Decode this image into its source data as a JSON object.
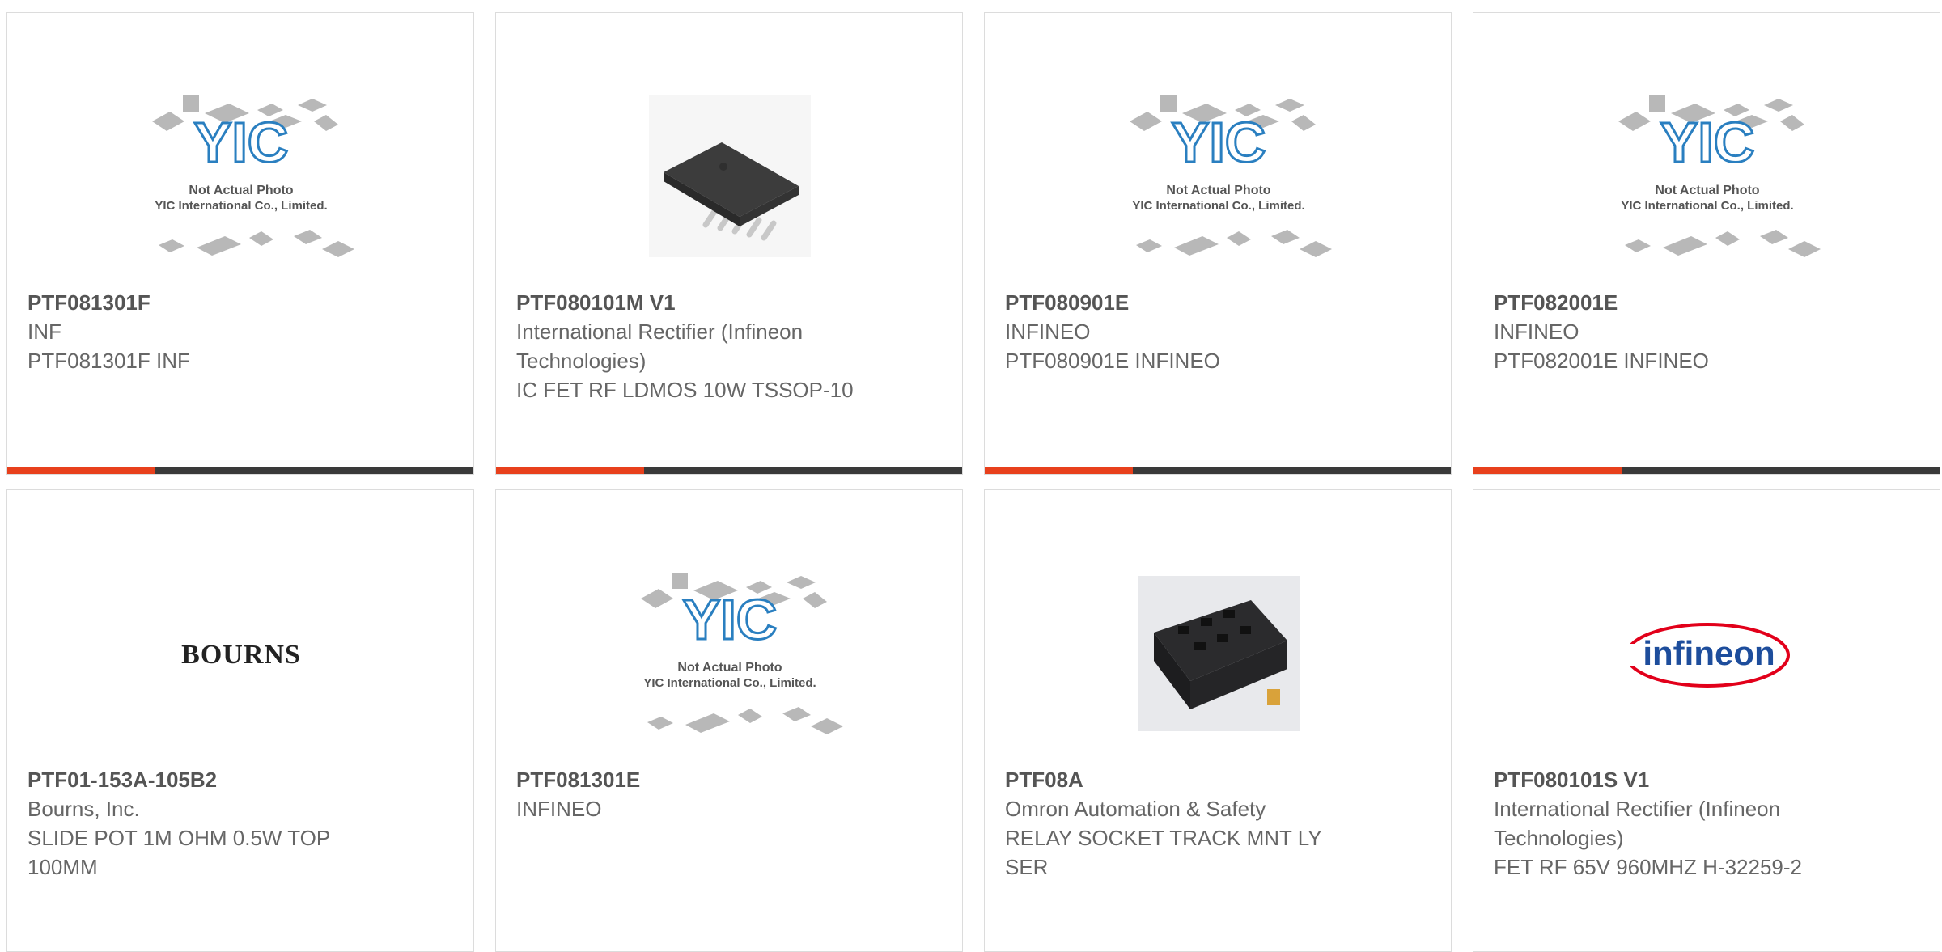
{
  "placeholder": {
    "line1": "Not Actual Photo",
    "line2": "YIC International Co., Limited.",
    "logo": "YIC"
  },
  "brand_logos": {
    "bourns": "BOURNS",
    "infineon": "infineon"
  },
  "colors": {
    "accent": "#e8401c",
    "bar": "#3a3a3a",
    "text": "#666666",
    "yic_blue": "#2a7fc0"
  },
  "cards": [
    {
      "part": "PTF081301F",
      "manufacturer": "INF",
      "description": "PTF081301F INF",
      "image": "yic-placeholder"
    },
    {
      "part": "PTF080101M V1",
      "manufacturer": "International Rectifier (Infineon Technologies)",
      "description": "IC FET RF LDMOS 10W TSSOP-10",
      "image": "tssop-chip-photo"
    },
    {
      "part": "PTF080901E",
      "manufacturer": "INFINEO",
      "description": "PTF080901E INFINEO",
      "image": "yic-placeholder"
    },
    {
      "part": "PTF082001E",
      "manufacturer": "INFINEO",
      "description": "PTF082001E INFINEO",
      "image": "yic-placeholder"
    },
    {
      "part": "PTF01-153A-105B2",
      "manufacturer": "Bourns, Inc.",
      "description": "SLIDE POT 1M OHM 0.5W TOP 100MM",
      "image": "bourns-logo"
    },
    {
      "part": "PTF081301E",
      "manufacturer": "INFINEO",
      "description": "",
      "image": "yic-placeholder"
    },
    {
      "part": "PTF08A",
      "manufacturer": "Omron Automation & Safety",
      "description": "RELAY SOCKET TRACK MNT LY SER",
      "image": "relay-socket-photo"
    },
    {
      "part": "PTF080101S V1",
      "manufacturer": "International Rectifier (Infineon Technologies)",
      "description": "FET RF 65V 960MHZ H-32259-2",
      "image": "infineon-logo"
    }
  ]
}
